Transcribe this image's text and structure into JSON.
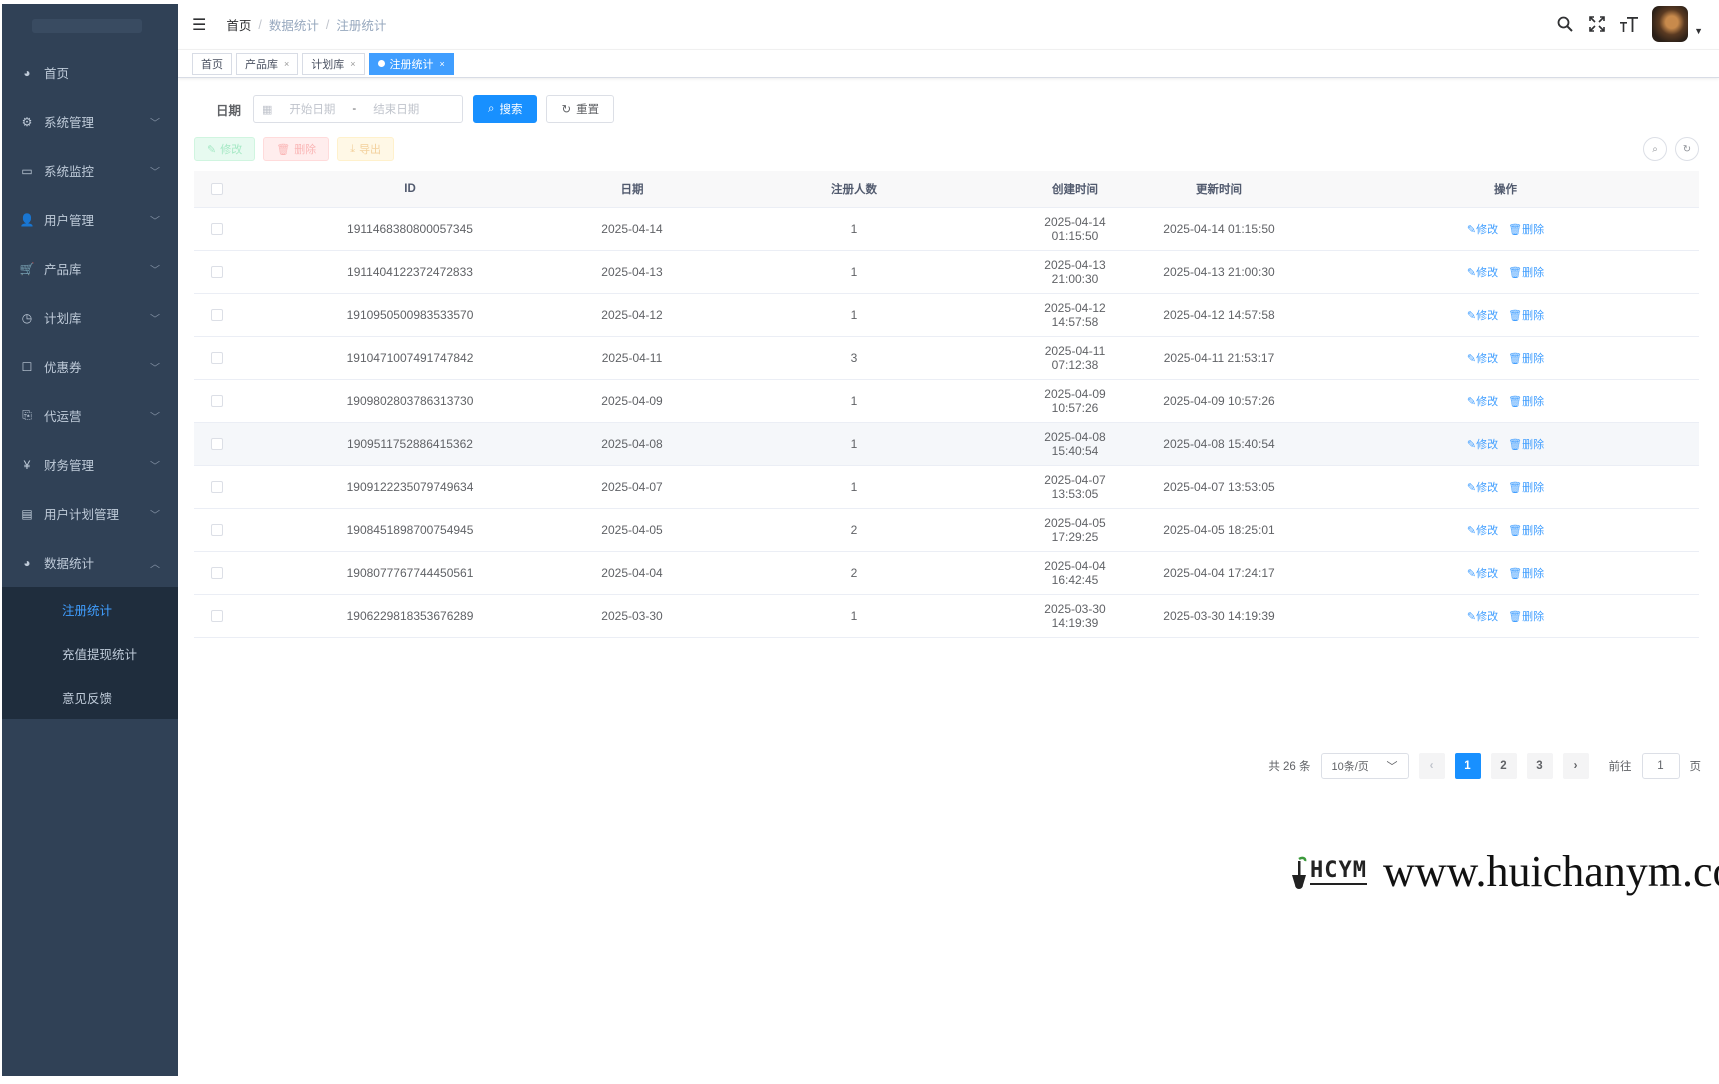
{
  "sidebar": {
    "items": [
      {
        "label": "首页",
        "icon": "dashboard-icon"
      },
      {
        "label": "系统管理",
        "icon": "gear-icon"
      },
      {
        "label": "系统监控",
        "icon": "monitor-icon"
      },
      {
        "label": "用户管理",
        "icon": "user-icon"
      },
      {
        "label": "产品库",
        "icon": "cart-icon"
      },
      {
        "label": "计划库",
        "icon": "clock-icon"
      },
      {
        "label": "优惠券",
        "icon": "coupon-icon"
      },
      {
        "label": "代运营",
        "icon": "operation-icon"
      },
      {
        "label": "财务管理",
        "icon": "yen-icon"
      },
      {
        "label": "用户计划管理",
        "icon": "list-icon"
      },
      {
        "label": "数据统计",
        "icon": "dashboard-icon"
      }
    ],
    "submenu": [
      {
        "label": "注册统计",
        "active": true
      },
      {
        "label": "充值提现统计",
        "active": false
      },
      {
        "label": "意见反馈",
        "active": false
      }
    ]
  },
  "header": {
    "breadcrumb": [
      "首页",
      "数据统计",
      "注册统计"
    ]
  },
  "tags": [
    {
      "label": "首页"
    },
    {
      "label": "产品库"
    },
    {
      "label": "计划库"
    },
    {
      "label": "注册统计"
    }
  ],
  "search": {
    "label": "日期",
    "start_placeholder": "开始日期",
    "range_separator": "-",
    "end_placeholder": "结束日期",
    "search_label": "搜索",
    "reset_label": "重置"
  },
  "toolbar": {
    "edit_label": "修改",
    "delete_label": "删除",
    "export_label": "导出"
  },
  "table": {
    "columns": [
      "ID",
      "日期",
      "注册人数",
      "创建时间",
      "更新时间",
      "操作"
    ],
    "edit_label": "修改",
    "delete_label": "删除",
    "rows": [
      {
        "id": "1911468380800057345",
        "date": "2025-04-14",
        "count": "1",
        "created": "2025-04-14 01:15:50",
        "updated": "2025-04-14 01:15:50"
      },
      {
        "id": "1911404122372472833",
        "date": "2025-04-13",
        "count": "1",
        "created": "2025-04-13 21:00:30",
        "updated": "2025-04-13 21:00:30"
      },
      {
        "id": "1910950500983533570",
        "date": "2025-04-12",
        "count": "1",
        "created": "2025-04-12 14:57:58",
        "updated": "2025-04-12 14:57:58"
      },
      {
        "id": "1910471007491747842",
        "date": "2025-04-11",
        "count": "3",
        "created": "2025-04-11 07:12:38",
        "updated": "2025-04-11 21:53:17"
      },
      {
        "id": "1909802803786313730",
        "date": "2025-04-09",
        "count": "1",
        "created": "2025-04-09 10:57:26",
        "updated": "2025-04-09 10:57:26"
      },
      {
        "id": "1909511752886415362",
        "date": "2025-04-08",
        "count": "1",
        "created": "2025-04-08 15:40:54",
        "updated": "2025-04-08 15:40:54"
      },
      {
        "id": "1909122235079749634",
        "date": "2025-04-07",
        "count": "1",
        "created": "2025-04-07 13:53:05",
        "updated": "2025-04-07 13:53:05"
      },
      {
        "id": "1908451898700754945",
        "date": "2025-04-05",
        "count": "2",
        "created": "2025-04-05 17:29:25",
        "updated": "2025-04-05 18:25:01"
      },
      {
        "id": "1908077767744450561",
        "date": "2025-04-04",
        "count": "2",
        "created": "2025-04-04 16:42:45",
        "updated": "2025-04-04 17:24:17"
      },
      {
        "id": "1906229818353676289",
        "date": "2025-03-30",
        "count": "1",
        "created": "2025-03-30 14:19:39",
        "updated": "2025-03-30 14:19:39"
      }
    ]
  },
  "pagination": {
    "total_text": "共 26 条",
    "page_size": "10条/页",
    "pages": [
      "1",
      "2",
      "3"
    ],
    "current_page": "1",
    "goto_label": "前往",
    "goto_value": "1",
    "page_suffix": "页"
  },
  "watermark": {
    "logo_text": "HCYM",
    "url": "www.huichanym.com"
  },
  "colors": {
    "sidebar_bg": "#304156",
    "submenu_bg": "#1f2d3d",
    "primary": "#1890ff",
    "active_link": "#409eff"
  }
}
